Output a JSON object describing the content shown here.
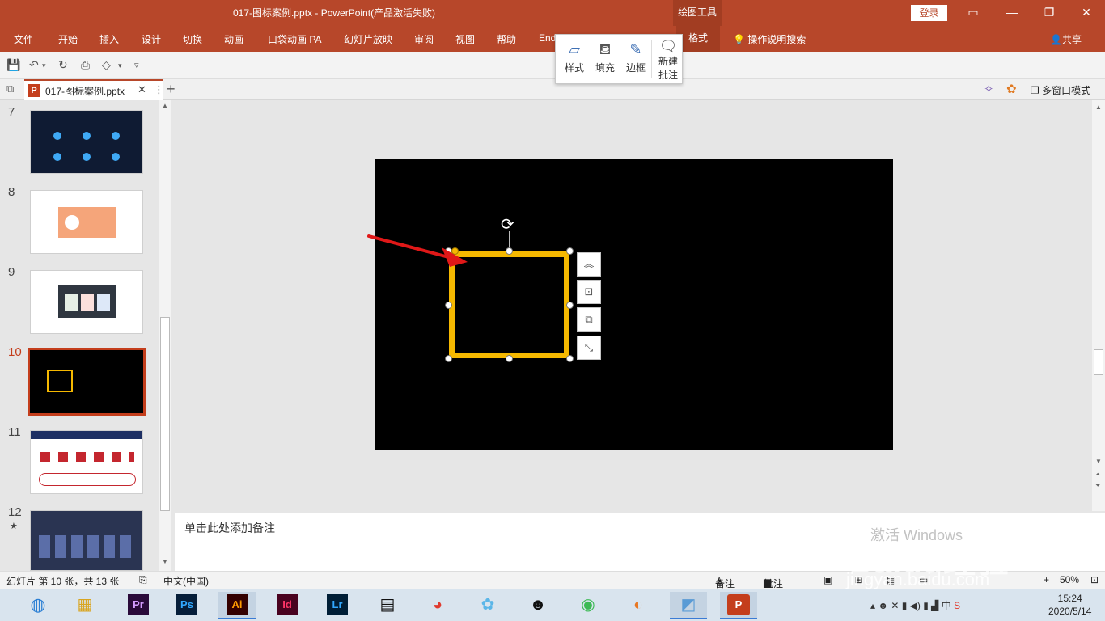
{
  "titlebar": {
    "title": "017-图标案例.pptx  -  PowerPoint(产品激活失败)",
    "context_tools": "绘图工具",
    "login": "登录"
  },
  "tabs": {
    "items": [
      "文件",
      "开始",
      "插入",
      "设计",
      "切换",
      "动画",
      "口袋动画 PA",
      "幻灯片放映",
      "审阅",
      "视图",
      "帮助",
      "End"
    ],
    "format": "格式",
    "tell_me": "操作说明搜索",
    "share": "共享"
  },
  "mini_toolbar": {
    "style": "样式",
    "fill": "填充",
    "border": "边框",
    "new_comment_1": "新建",
    "new_comment_2": "批注"
  },
  "doc_tab": {
    "name": "017-图标案例.pptx",
    "multi_window": "多窗口模式"
  },
  "slides": {
    "numbers": [
      "7",
      "8",
      "9",
      "10",
      "11",
      "12"
    ],
    "active": "10"
  },
  "notes": {
    "placeholder": "单击此处添加备注"
  },
  "status": {
    "slide_info": "幻灯片 第 10 张，共 13 张",
    "language": "中文(中国)",
    "notes": "备注",
    "comments": "批注",
    "zoom": "50%"
  },
  "taskbar": {
    "apps": [
      "Pr",
      "Ps",
      "Ai",
      "Id",
      "Lr"
    ],
    "time": "15:24",
    "date": "2020/5/14",
    "ime": "中"
  },
  "watermark": {
    "activate": "激活 Windows",
    "brand": "Baidu经验",
    "url": "jingyan.baidu.com"
  },
  "colors": {
    "accent": "#b7472a",
    "selected_rect": "#f5b800",
    "arrow": "#e01818"
  }
}
